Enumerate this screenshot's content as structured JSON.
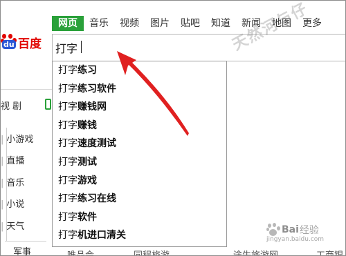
{
  "nav": {
    "tabs": [
      "网页",
      "音乐",
      "视频",
      "图片",
      "贴吧",
      "知道",
      "新闻",
      "地图",
      "更多"
    ],
    "active_tab": "网页",
    "active_color": "#2aa13a"
  },
  "logo": {
    "badge": "du",
    "name": "百度"
  },
  "search": {
    "query": "打字"
  },
  "suggestions": [
    {
      "prefix": "打字",
      "rest": "练习"
    },
    {
      "prefix": "打字",
      "rest": "练习软件"
    },
    {
      "prefix": "打字",
      "rest": "赚钱网"
    },
    {
      "prefix": "打字",
      "rest": "赚钱"
    },
    {
      "prefix": "打字",
      "rest": "速度测试"
    },
    {
      "prefix": "打字",
      "rest": "测试"
    },
    {
      "prefix": "打字",
      "rest": "游戏"
    },
    {
      "prefix": "打字",
      "rest": "练习在线"
    },
    {
      "prefix": "打字",
      "rest": "软件"
    },
    {
      "prefix": "打字",
      "rest": "机进口清关"
    }
  ],
  "background_page": {
    "tv_label": "视 剧",
    "left_links": [
      "小游戏",
      "直播",
      "音乐",
      "小说",
      "天气"
    ],
    "left_bottom": "军事",
    "bottom_row": [
      "唯品会",
      "同程旅游",
      "途牛旅游网",
      "工商银"
    ]
  },
  "watermark": {
    "text": "天然河与仔",
    "brand_bold": "Bai",
    "brand_rest": "经验",
    "url": "jingyan.baidu.com"
  },
  "annotation_color": "#e02020"
}
